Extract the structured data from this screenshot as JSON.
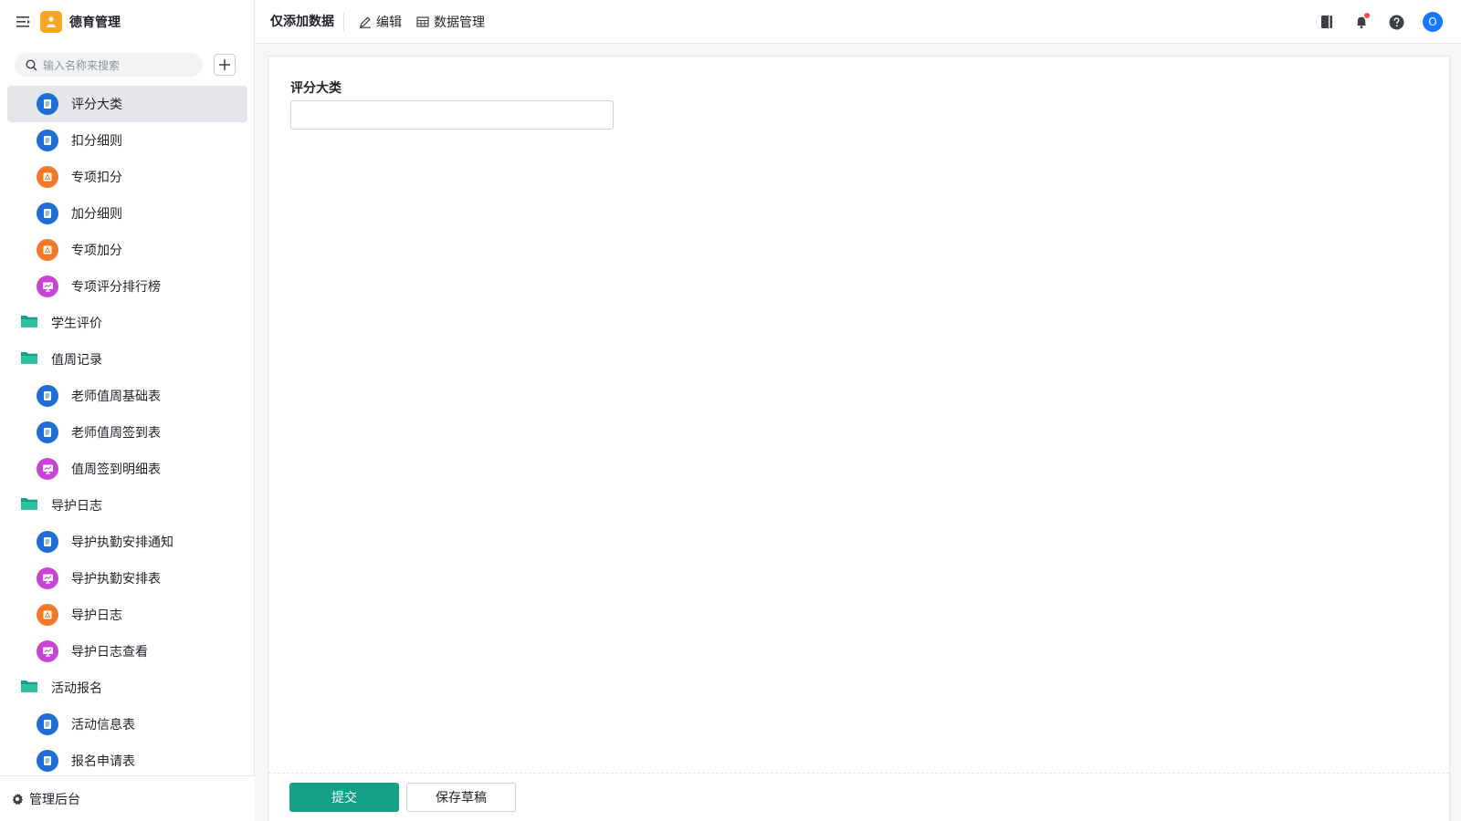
{
  "app": {
    "title": "德育管理"
  },
  "sidebar": {
    "search_placeholder": "输入名称来搜索",
    "items": [
      {
        "label": "评分大类",
        "kind": "child",
        "icon": "form-icon",
        "color": "#1e6fd9",
        "active": true
      },
      {
        "label": "扣分细则",
        "kind": "child",
        "icon": "form-icon",
        "color": "#1e6fd9"
      },
      {
        "label": "专项扣分",
        "kind": "child",
        "icon": "flow-icon",
        "color": "#f07a28"
      },
      {
        "label": "加分细则",
        "kind": "child",
        "icon": "form-icon",
        "color": "#1e6fd9"
      },
      {
        "label": "专项加分",
        "kind": "child",
        "icon": "flow-icon",
        "color": "#f07a28"
      },
      {
        "label": "专项评分排行榜",
        "kind": "child",
        "icon": "report-icon",
        "color": "#c844d6"
      },
      {
        "label": "学生评价",
        "kind": "folder",
        "icon": "folder-icon",
        "color": "#14a085"
      },
      {
        "label": "值周记录",
        "kind": "folder",
        "icon": "folder-icon",
        "color": "#14a085"
      },
      {
        "label": "老师值周基础表",
        "kind": "child",
        "icon": "form-icon",
        "color": "#1e6fd9"
      },
      {
        "label": "老师值周签到表",
        "kind": "child",
        "icon": "form-icon",
        "color": "#1e6fd9"
      },
      {
        "label": "值周签到明细表",
        "kind": "child",
        "icon": "report-icon",
        "color": "#c844d6"
      },
      {
        "label": "导护日志",
        "kind": "folder",
        "icon": "folder-icon",
        "color": "#14a085"
      },
      {
        "label": "导护执勤安排通知",
        "kind": "child",
        "icon": "form-icon",
        "color": "#1e6fd9"
      },
      {
        "label": "导护执勤安排表",
        "kind": "child",
        "icon": "report-icon",
        "color": "#c844d6"
      },
      {
        "label": "导护日志",
        "kind": "child",
        "icon": "flow-icon",
        "color": "#f07a28"
      },
      {
        "label": "导护日志查看",
        "kind": "child",
        "icon": "report-icon",
        "color": "#c844d6"
      },
      {
        "label": "活动报名",
        "kind": "folder",
        "icon": "folder-icon",
        "color": "#14a085"
      },
      {
        "label": "活动信息表",
        "kind": "child",
        "icon": "form-icon",
        "color": "#1e6fd9"
      },
      {
        "label": "报名申请表",
        "kind": "child",
        "icon": "form-icon",
        "color": "#1e6fd9"
      }
    ],
    "footer_label": "管理后台"
  },
  "topbar": {
    "page_name": "仅添加数据",
    "edit_label": "编辑",
    "data_manage_label": "数据管理",
    "avatar_letter": "O"
  },
  "form": {
    "field_label": "评分大类",
    "field_value": "",
    "submit_label": "提交",
    "draft_label": "保存草稿"
  },
  "colors": {
    "accent": "#14a085",
    "form_icon": "#1e6fd9",
    "flow_icon": "#f07a28",
    "report_icon": "#c844d6",
    "logo": "#f5a623"
  }
}
